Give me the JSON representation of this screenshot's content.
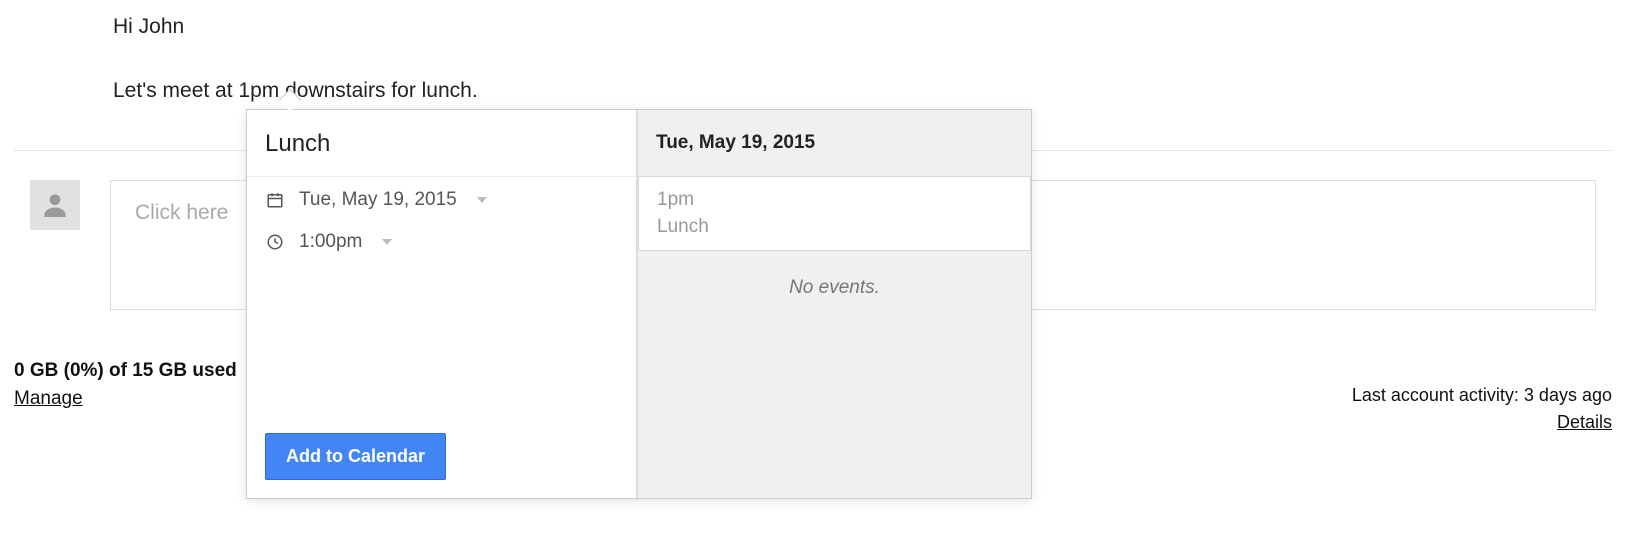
{
  "email": {
    "greeting": "Hi John",
    "body_line": "Let's meet at 1pm downstairs for lunch."
  },
  "reply": {
    "placeholder_visible": "Click here"
  },
  "footer": {
    "storage": "0 GB (0%) of 15 GB used",
    "manage": "Manage",
    "activity": "Last account activity: 3 days ago",
    "details": "Details"
  },
  "calendar_popover": {
    "title": "Lunch",
    "date": "Tue, May 19, 2015",
    "time": "1:00pm",
    "add_button": "Add to Calendar",
    "preview": {
      "header": "Tue, May 19, 2015",
      "proposed": {
        "time": "1pm",
        "name": "Lunch"
      },
      "empty_text": "No events."
    }
  }
}
